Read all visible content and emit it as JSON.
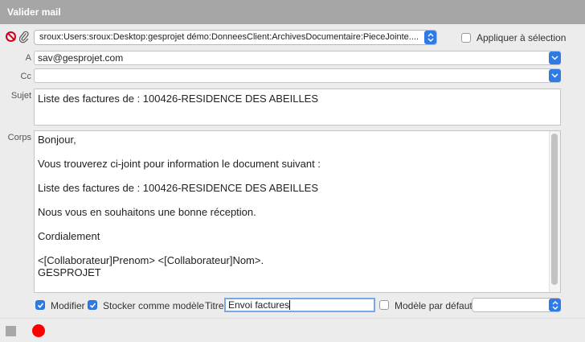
{
  "window": {
    "title": "Valider mail"
  },
  "attachment": {
    "path": "sroux:Users:sroux:Desktop:gesprojet démo:DonneesClient:ArchivesDocumentaire:PieceJointe....",
    "apply_label": "Appliquer à sélection",
    "apply_checked": false
  },
  "fields": {
    "to_label": "A",
    "to_value": "sav@gesprojet.com",
    "cc_label": "Cc",
    "cc_value": "",
    "subject_label": "Sujet",
    "subject_value": "Liste des factures de : 100426-RESIDENCE DES ABEILLES",
    "body_label": "Corps"
  },
  "body_lines": [
    "Bonjour,",
    "",
    "Vous trouverez ci-joint pour information le document suivant :",
    "",
    "Liste des factures de : 100426-RESIDENCE DES ABEILLES",
    "",
    "Nous vous en souhaitons une bonne réception.",
    "",
    "Cordialement",
    "",
    "<[Collaborateur]Prenom> <[Collaborateur]Nom>.",
    "GESPROJET"
  ],
  "options": {
    "modify_label": "Modifier",
    "modify_checked": true,
    "store_label": "Stocker comme modèle",
    "store_checked": true,
    "title_label": "Titre",
    "title_value": "Envoi factures",
    "default_label": "Modèle par défaut",
    "default_checked": false,
    "model_value": ""
  },
  "colors": {
    "accent": "#2f7be6",
    "titlebar": "#a6a6a6",
    "record": "#ff0000",
    "remove": "#d0021b"
  }
}
